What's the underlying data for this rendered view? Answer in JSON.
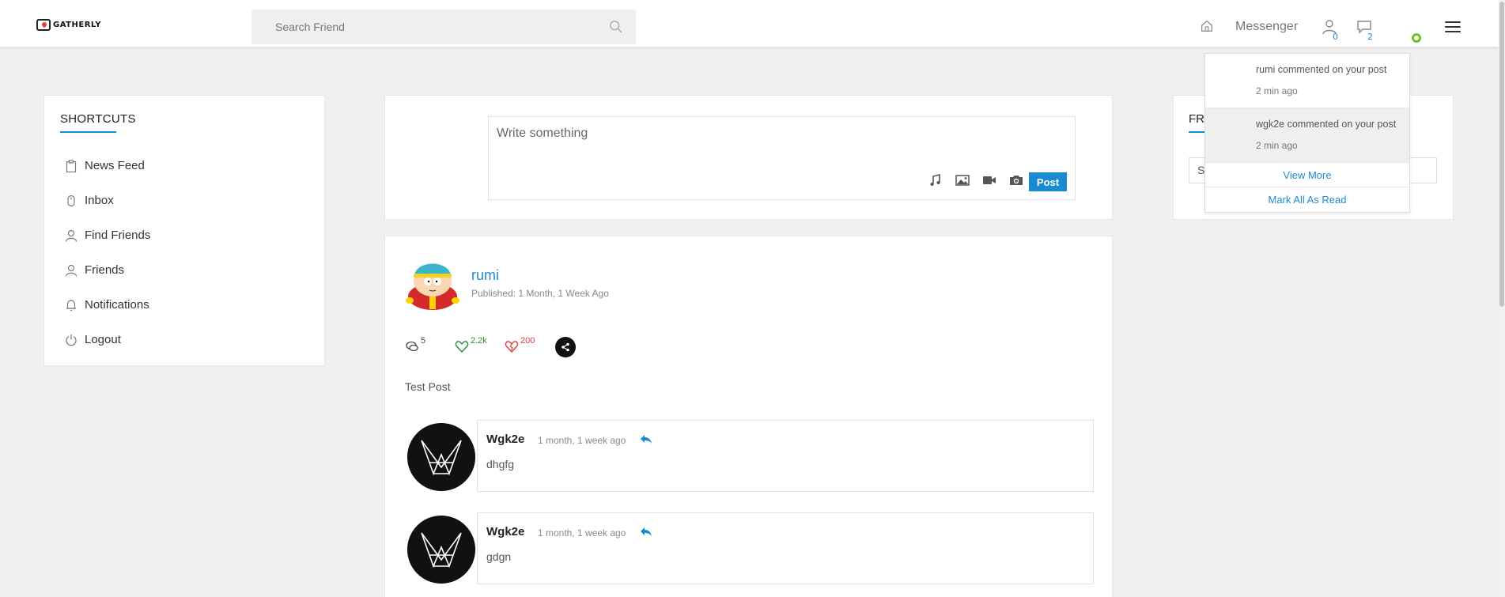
{
  "header": {
    "logo_text": "GATHERLY",
    "search_placeholder": "Search Friend",
    "messenger_label": "Messenger",
    "friend_requests_count": "0",
    "messages_count": "2"
  },
  "shortcuts": {
    "title": "SHORTCUTS",
    "items": [
      {
        "label": "News Feed",
        "icon": "clipboard-icon"
      },
      {
        "label": "Inbox",
        "icon": "mouse-icon"
      },
      {
        "label": "Find Friends",
        "icon": "user-icon"
      },
      {
        "label": "Friends",
        "icon": "user-icon"
      },
      {
        "label": "Notifications",
        "icon": "bell-icon"
      },
      {
        "label": "Logout",
        "icon": "power-icon"
      }
    ]
  },
  "composer": {
    "placeholder": "Write something",
    "post_label": "Post"
  },
  "post": {
    "author": "rumi",
    "published": "Published: 1 Month, 1 Week Ago",
    "comments_count": "5",
    "likes_count": "2.2k",
    "loves_count": "200",
    "text": "Test Post"
  },
  "comments": [
    {
      "name": "Wgk2e",
      "time": "1 month, 1 week ago",
      "text": "dhgfg"
    },
    {
      "name": "Wgk2e",
      "time": "1 month, 1 week ago",
      "text": "gdgn"
    }
  ],
  "friends_panel": {
    "title_visible": "FR",
    "search_visible": "S"
  },
  "notifications": {
    "items": [
      {
        "message": "rumi commented on your post",
        "time": "2 min ago"
      },
      {
        "message": "wgk2e commented on your post",
        "time": "2 min ago"
      }
    ],
    "view_more_label": "View More",
    "mark_read_label": "Mark All As Read"
  },
  "colors": {
    "accent": "#1b8bd1",
    "online": "#7cbb21",
    "like": "#2e8b3a",
    "love": "#e23b3b"
  }
}
